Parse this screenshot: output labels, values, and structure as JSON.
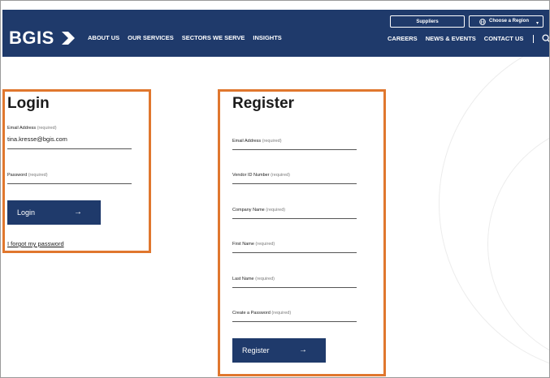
{
  "header": {
    "logo_text": "BGIS",
    "nav_left": [
      "ABOUT US",
      "OUR SERVICES",
      "SECTORS WE SERVE",
      "INSIGHTS"
    ],
    "nav_right": [
      "CAREERS",
      "NEWS & EVENTS",
      "CONTACT US"
    ],
    "suppliers_label": "Suppliers",
    "region_label": "Choose a Region",
    "colors": {
      "header_bg": "#1f3a6b",
      "accent_outline": "#e0772e"
    },
    "icons": [
      "logo-arrow-icon",
      "search-icon",
      "globe-icon",
      "caret-down-icon"
    ]
  },
  "login": {
    "title": "Login",
    "email_label": "Email Address",
    "email_required": "(required)",
    "email_value": "tina.kresse@bgis.com",
    "password_label": "Password",
    "password_required": "(required)",
    "button_label": "Login",
    "button_arrow": "→",
    "forgot_link": "I forgot my password"
  },
  "register": {
    "title": "Register",
    "fields": [
      {
        "label": "Email Address",
        "required": "(required)"
      },
      {
        "label": "Vendor ID Number",
        "required": "(required)"
      },
      {
        "label": "Company Name",
        "required": "(required)"
      },
      {
        "label": "First Name",
        "required": "(required)"
      },
      {
        "label": "Last Name",
        "required": "(required)"
      },
      {
        "label": "Create a Password",
        "required": "(required)"
      }
    ],
    "button_label": "Register",
    "button_arrow": "→"
  }
}
